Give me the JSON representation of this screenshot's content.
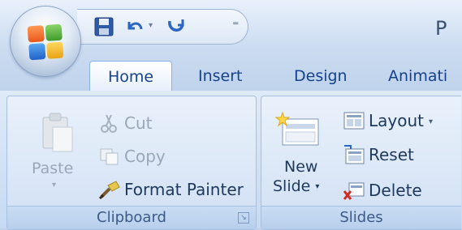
{
  "app": {
    "title_partial": "P"
  },
  "quick_access": {
    "save_icon": "save-icon",
    "undo_icon": "undo-icon",
    "redo_icon": "redo-icon",
    "customize_glyph": "⁼"
  },
  "tabs": [
    {
      "label": "Home",
      "active": true
    },
    {
      "label": "Insert",
      "active": false
    },
    {
      "label": "Design",
      "active": false
    },
    {
      "label": "Animati",
      "active": false
    }
  ],
  "groups": {
    "clipboard": {
      "label": "Clipboard",
      "paste": "Paste",
      "cut": "Cut",
      "copy": "Copy",
      "format_painter": "Format Painter"
    },
    "slides": {
      "label": "Slides",
      "new_slide_line1": "New",
      "new_slide_line2": "Slide",
      "layout": "Layout",
      "reset": "Reset",
      "delete": "Delete"
    }
  },
  "colors": {
    "accent": "#15428b",
    "ribbon_bg": "#d3e2f5",
    "disabled_text": "#9aa7b8"
  }
}
